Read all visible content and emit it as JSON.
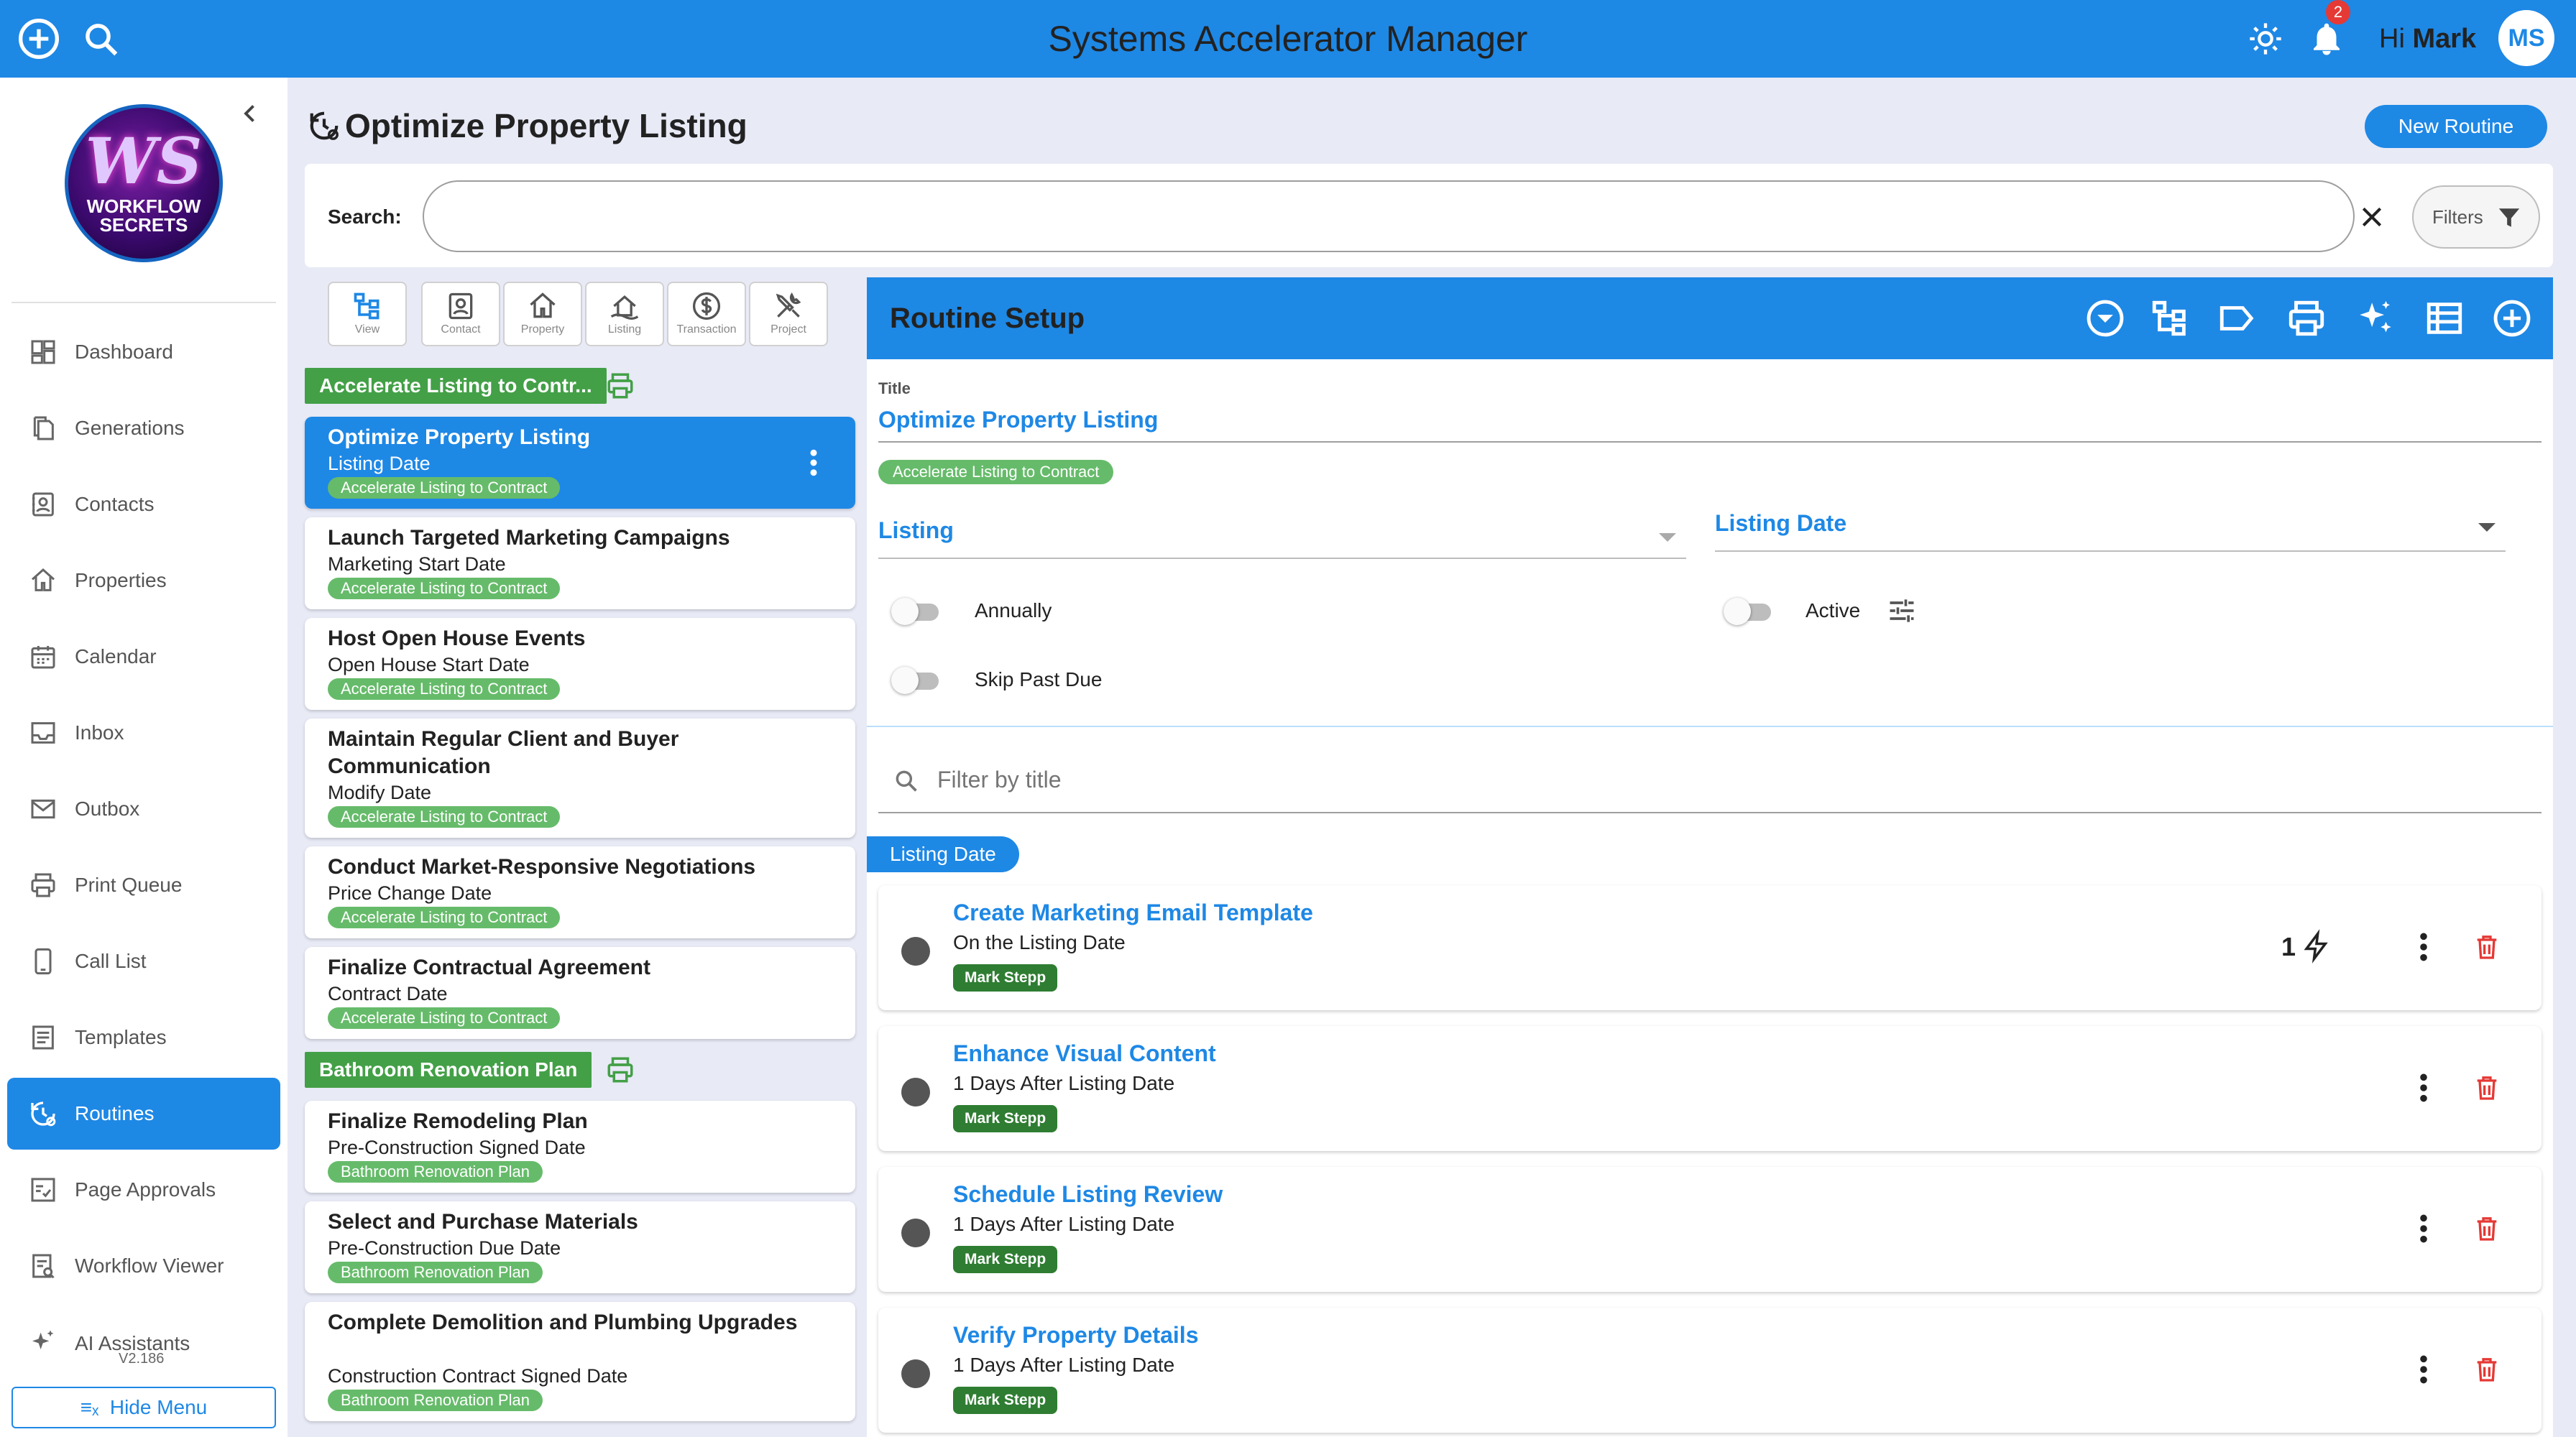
{
  "app": {
    "title": "Systems Accelerator Manager",
    "greeting_prefix": "Hi",
    "user_name": "Mark",
    "user_initials": "MS",
    "notification_count": "2"
  },
  "logo": {
    "letters": "WS",
    "line1": "WORKFLOW",
    "line2": "SECRETS"
  },
  "sidebar": {
    "items": [
      {
        "label": "Dashboard",
        "icon": "dashboard-icon"
      },
      {
        "label": "Generations",
        "icon": "copy-icon"
      },
      {
        "label": "Contacts",
        "icon": "contact-icon"
      },
      {
        "label": "Properties",
        "icon": "home-icon"
      },
      {
        "label": "Calendar",
        "icon": "calendar-icon"
      },
      {
        "label": "Inbox",
        "icon": "inbox-icon"
      },
      {
        "label": "Outbox",
        "icon": "mail-icon"
      },
      {
        "label": "Print Queue",
        "icon": "printer-icon"
      },
      {
        "label": "Call List",
        "icon": "phone-icon"
      },
      {
        "label": "Templates",
        "icon": "document-icon"
      },
      {
        "label": "Routines",
        "icon": "routine-icon",
        "active": true
      },
      {
        "label": "Page Approvals",
        "icon": "approval-icon"
      },
      {
        "label": "Workflow Viewer",
        "icon": "workflow-icon"
      },
      {
        "label": "AI Assistants",
        "icon": "sparkle-icon"
      }
    ],
    "version": "V2.186",
    "hide_menu": "Hide Menu"
  },
  "page": {
    "title": "Optimize Property Listing",
    "new_routine": "New Routine"
  },
  "search": {
    "label": "Search:",
    "value": "",
    "filters": "Filters"
  },
  "type_tabs": [
    {
      "label": "View",
      "icon": "hierarchy-icon"
    },
    {
      "label": "Contact",
      "icon": "contact-card-icon"
    },
    {
      "label": "Property",
      "icon": "house-icon"
    },
    {
      "label": "Listing",
      "icon": "listing-icon"
    },
    {
      "label": "Transaction",
      "icon": "dollar-icon"
    },
    {
      "label": "Project",
      "icon": "tools-icon"
    }
  ],
  "groups": [
    {
      "name": "Accelerate Listing to Contr...",
      "routines": [
        {
          "title": "Optimize Property Listing",
          "date": "Listing Date",
          "badge": "Accelerate Listing to Contract",
          "selected": true
        },
        {
          "title": "Launch Targeted Marketing Campaigns",
          "date": "Marketing Start Date",
          "badge": "Accelerate Listing to Contract"
        },
        {
          "title": "Host Open House Events",
          "date": "Open House Start Date",
          "badge": "Accelerate Listing to Contract"
        },
        {
          "title": "Maintain Regular Client and Buyer Communication",
          "date": "Modify Date",
          "badge": "Accelerate Listing to Contract"
        },
        {
          "title": "Conduct Market-Responsive Negotiations",
          "date": "Price Change Date",
          "badge": "Accelerate Listing to Contract"
        },
        {
          "title": "Finalize Contractual Agreement",
          "date": "Contract Date",
          "badge": "Accelerate Listing to Contract"
        }
      ]
    },
    {
      "name": "Bathroom Renovation Plan",
      "routines": [
        {
          "title": "Finalize Remodeling Plan",
          "date": "Pre-Construction Signed Date",
          "badge": "Bathroom Renovation Plan"
        },
        {
          "title": "Select and Purchase Materials",
          "date": "Pre-Construction Due Date",
          "badge": "Bathroom Renovation Plan"
        },
        {
          "title": "Complete Demolition and Plumbing Upgrades",
          "date": "Construction Contract Signed Date",
          "badge": "Bathroom Renovation Plan"
        }
      ]
    }
  ],
  "setup": {
    "header": "Routine Setup",
    "title_label": "Title",
    "title_value": "Optimize Property Listing",
    "title_chip": "Accelerate Listing to Contract",
    "type_select": "Listing",
    "date_select": "Listing Date",
    "toggles": {
      "annually": "Annually",
      "active": "Active",
      "skip_past_due": "Skip Past Due"
    },
    "filter_placeholder": "Filter by title",
    "date_chip": "Listing Date",
    "tasks": [
      {
        "title": "Create Marketing Email Template",
        "timing": "On the Listing Date",
        "assignee": "Mark Stepp",
        "count": "1"
      },
      {
        "title": "Enhance Visual Content",
        "timing": "1 Days After Listing Date",
        "assignee": "Mark Stepp"
      },
      {
        "title": "Schedule Listing Review",
        "timing": "1 Days After Listing Date",
        "assignee": "Mark Stepp"
      },
      {
        "title": "Verify Property Details",
        "timing": "1 Days After Listing Date",
        "assignee": "Mark Stepp"
      }
    ]
  },
  "colors": {
    "primary": "#1e88e5",
    "green": "#43a047",
    "badge_green": "#66bb6a",
    "dark_green": "#2e7d32",
    "delete": "#e53935"
  }
}
